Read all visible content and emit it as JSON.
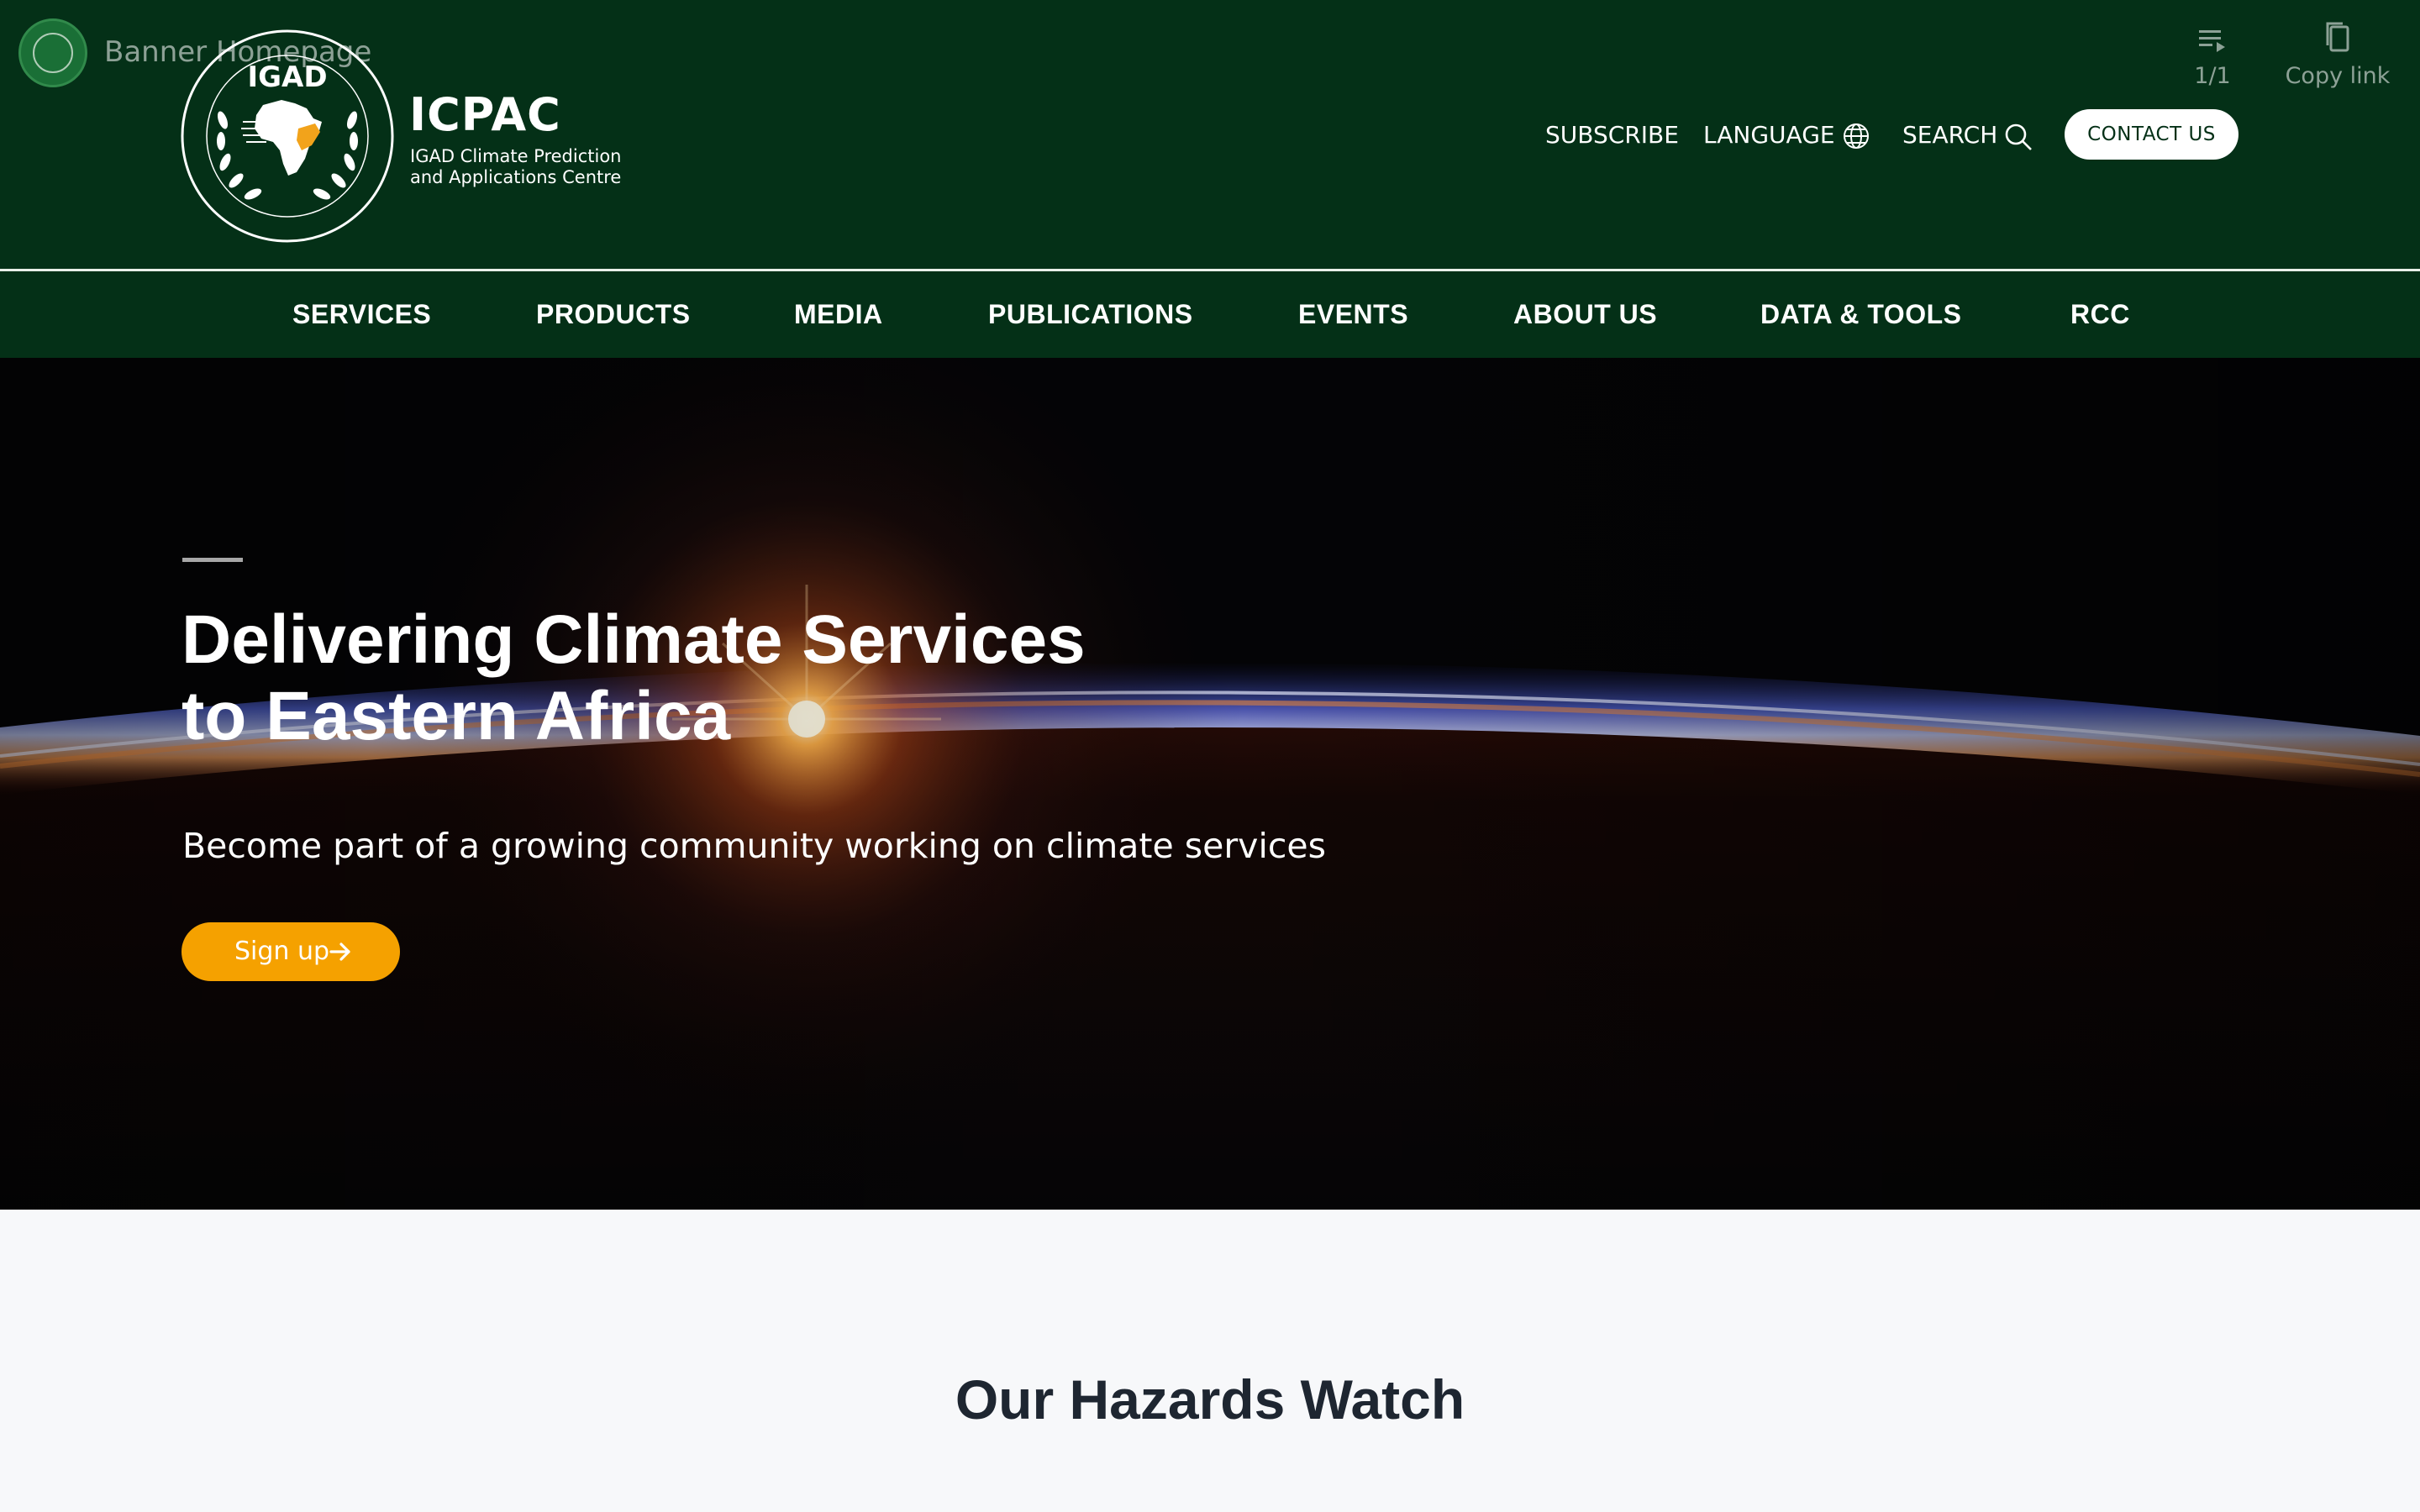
{
  "embed": {
    "title": "Banner Homepage",
    "page_counter": "1/1",
    "copy_link_label": "Copy link"
  },
  "brand": {
    "seal_text": "IGAD",
    "name": "ICPAC",
    "subtitle": "IGAD Climate Prediction\nand Applications Centre"
  },
  "utility": {
    "subscribe": "SUBSCRIBE",
    "language": "LANGUAGE",
    "search": "SEARCH",
    "contact": "CONTACT US"
  },
  "nav": {
    "items": [
      "SERVICES",
      "PRODUCTS",
      "MEDIA",
      "PUBLICATIONS",
      "EVENTS",
      "ABOUT US",
      "DATA & TOOLS",
      "RCC"
    ]
  },
  "hero": {
    "title": "Delivering Climate Services\nto Eastern Africa",
    "subtitle": "Become part of a growing community working on climate services",
    "cta": "Sign up"
  },
  "section": {
    "title": "Our Hazards Watch"
  },
  "colors": {
    "header_bg": "#043017",
    "cta_orange": "#f5a100",
    "logo_accent": "#f2a31b"
  },
  "icons": {
    "language": "globe-icon",
    "search": "search-icon",
    "signup": "arrow-right-icon",
    "playlist": "playlist-icon",
    "copy": "copy-icon"
  }
}
